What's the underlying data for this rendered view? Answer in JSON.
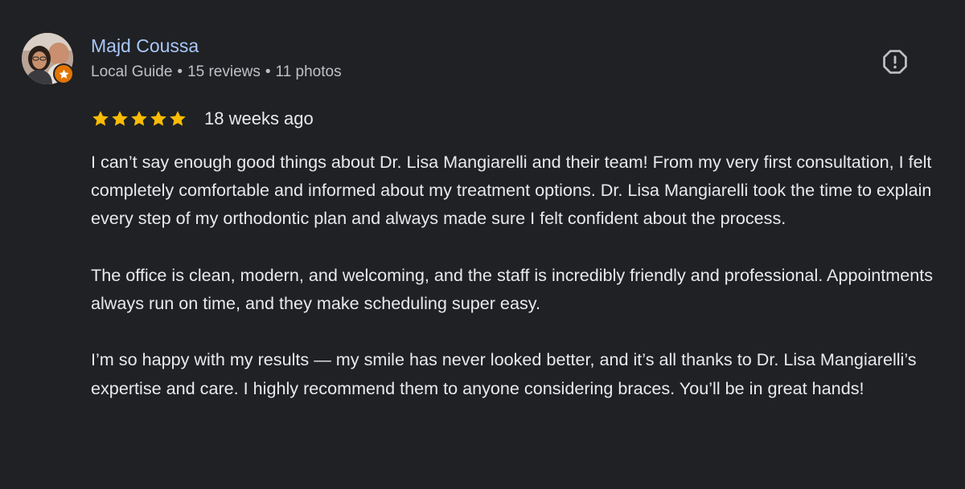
{
  "review": {
    "author": {
      "name": "Majd Coussa",
      "role": "Local Guide",
      "reviews": "15 reviews",
      "photos": "11 photos",
      "separator": "•",
      "avatar_icon": "profile-photo",
      "badge_icon": "local-guide-star-icon",
      "badge_color": "#e37400"
    },
    "rating": {
      "stars": 5,
      "max_stars": 5,
      "star_color": "#fbbc04",
      "date": "18 weeks ago"
    },
    "report_icon": "report-exclamation-icon",
    "paragraphs": [
      "I can’t say enough good things about Dr. Lisa Mangiarelli and their team! From my very first consultation, I felt completely comfortable and informed about my treatment options. Dr. Lisa Mangiarelli took the time to explain every step of my orthodontic plan and always made sure I felt confident about the process.",
      "The office is clean, modern, and welcoming, and the staff is incredibly friendly and professional. Appointments always run on time, and they make scheduling super easy.",
      "I’m so happy with my results — my smile has never looked better, and it’s all thanks to Dr. Lisa Mangiarelli’s expertise and care. I highly recommend them to anyone considering braces. You’ll be in great hands!"
    ]
  },
  "colors": {
    "background": "#202124",
    "name_link": "#a8c7fa",
    "meta_text": "#bdc1c6",
    "body_text": "#e8eaed"
  }
}
